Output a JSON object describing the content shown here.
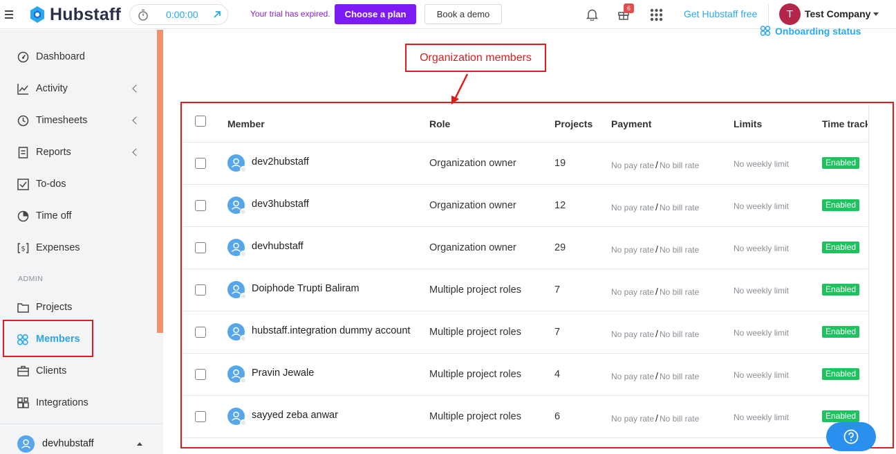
{
  "topbar": {
    "brand": "Hubstaff",
    "timer": "0:00:00",
    "trial_text": "Your trial has expired.",
    "choose_plan": "Choose a plan",
    "book_demo": "Book a demo",
    "gift_badge": "6",
    "get_free": "Get Hubstaff free",
    "company_initial": "T",
    "company_name": "Test Company"
  },
  "sidebar": {
    "items": [
      {
        "label": "Dashboard",
        "icon": "dashboard-icon"
      },
      {
        "label": "Activity",
        "icon": "activity-icon"
      },
      {
        "label": "Timesheets",
        "icon": "clock-icon"
      },
      {
        "label": "Reports",
        "icon": "reports-icon"
      },
      {
        "label": "To-dos",
        "icon": "todo-icon"
      },
      {
        "label": "Time off",
        "icon": "timeoff-icon"
      },
      {
        "label": "Expenses",
        "icon": "expenses-icon"
      }
    ],
    "admin_label": "ADMIN",
    "admin_items": [
      {
        "label": "Projects",
        "icon": "folder-icon"
      },
      {
        "label": "Members",
        "icon": "members-icon"
      },
      {
        "label": "Clients",
        "icon": "briefcase-icon"
      },
      {
        "label": "Integrations",
        "icon": "integrations-icon"
      }
    ],
    "current_user": "devhubstaff"
  },
  "main": {
    "onboarding": "Onboarding status",
    "callout": "Organization members",
    "columns": [
      "Member",
      "Role",
      "Projects",
      "Payment",
      "Limits",
      "Time track"
    ],
    "rows": [
      {
        "name": "dev2hubstaff",
        "role": "Organization owner",
        "projects": "19",
        "pay": "No pay rate",
        "bill": "No bill rate",
        "limit": "No weekly limit",
        "status": "Enabled"
      },
      {
        "name": "dev3hubstaff",
        "role": "Organization owner",
        "projects": "12",
        "pay": "No pay rate",
        "bill": "No bill rate",
        "limit": "No weekly limit",
        "status": "Enabled"
      },
      {
        "name": "devhubstaff",
        "role": "Organization owner",
        "projects": "29",
        "pay": "No pay rate",
        "bill": "No bill rate",
        "limit": "No weekly limit",
        "status": "Enabled"
      },
      {
        "name": "Doiphode Trupti Baliram",
        "role": "Multiple project roles",
        "projects": "7",
        "pay": "No pay rate",
        "bill": "No bill rate",
        "limit": "No weekly limit",
        "status": "Enabled"
      },
      {
        "name": "hubstaff.integration dummy account",
        "role": "Multiple project roles",
        "projects": "7",
        "pay": "No pay rate",
        "bill": "No bill rate",
        "limit": "No weekly limit",
        "status": "Enabled"
      },
      {
        "name": "Pravin Jewale",
        "role": "Multiple project roles",
        "projects": "4",
        "pay": "No pay rate",
        "bill": "No bill rate",
        "limit": "No weekly limit",
        "status": "Enabled"
      },
      {
        "name": "sayyed zeba anwar",
        "role": "Multiple project roles",
        "projects": "6",
        "pay": "No pay rate",
        "bill": "No bill rate",
        "limit": "No weekly limit",
        "status": "Enabled"
      }
    ]
  },
  "colors": {
    "accent": "#2aa7ee",
    "plan_button": "#7c1bf5",
    "annotation_red": "#e01b1b",
    "enabled_green": "#1dc35f"
  }
}
